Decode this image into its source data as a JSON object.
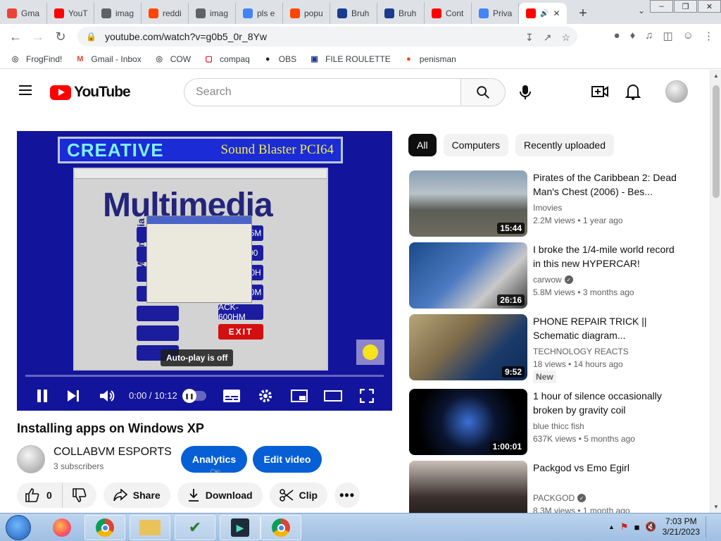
{
  "browser": {
    "tabs": [
      {
        "label": "Gma",
        "icon": "gmail-icon",
        "color": "#ea4335"
      },
      {
        "label": "YouT",
        "icon": "youtube-icon",
        "color": "#ff0000"
      },
      {
        "label": "imag",
        "icon": "globe-icon",
        "color": "#5f6368"
      },
      {
        "label": "reddi",
        "icon": "reddit-icon",
        "color": "#ff4500"
      },
      {
        "label": "imag",
        "icon": "globe-icon",
        "color": "#5f6368"
      },
      {
        "label": "pls e",
        "icon": "google-icon",
        "color": "#4285f4"
      },
      {
        "label": "popu",
        "icon": "reddit-icon",
        "color": "#ff4500"
      },
      {
        "label": "Bruh",
        "icon": "bruh-icon",
        "color": "#1a3c8c"
      },
      {
        "label": "Bruh",
        "icon": "bruh-icon",
        "color": "#1a3c8c"
      },
      {
        "label": "Cont",
        "icon": "youtube-icon",
        "color": "#ff0000"
      },
      {
        "label": "Priva",
        "icon": "google-icon",
        "color": "#4285f4"
      }
    ],
    "url": "youtube.com/watch?v=g0b5_0r_8Yw",
    "bookmarks": [
      {
        "label": "FrogFind!",
        "icon": "globe-icon"
      },
      {
        "label": "Gmail - Inbox",
        "icon": "gmail-icon"
      },
      {
        "label": "COW",
        "icon": "globe-icon"
      },
      {
        "label": "compaq",
        "icon": "compaq-icon"
      },
      {
        "label": "OBS",
        "icon": "github-icon"
      },
      {
        "label": "FILE ROULETTE",
        "icon": "file-roulette-icon"
      },
      {
        "label": "penisman",
        "icon": "reddit-icon"
      }
    ]
  },
  "youtube": {
    "logo_text": "YouTube",
    "search_placeholder": "Search",
    "video": {
      "banner_brand": "CREATIVE",
      "banner_product": "Sound Blaster PCI64",
      "screen_heading": "Multimedia",
      "autoplay_tooltip": "Auto-play is off",
      "time": "0:00 / 10:12",
      "buttons_right": [
        "ACK-595M",
        "ACK-600",
        "ACK-600H",
        "ACK-600M",
        "ACK-600HM",
        "EXIT"
      ]
    },
    "title": "Installing apps on Windows XP",
    "channel": {
      "name": "COLLABVM ESPORTS",
      "subs": "3 subscribers"
    },
    "analytics_label": "Analytics",
    "edit_label": "Edit video",
    "likes": "0",
    "share_label": "Share",
    "download_label": "Download",
    "clip_label": "Clip",
    "chips": [
      "All",
      "Computers",
      "Recently uploaded"
    ],
    "recommendations": [
      {
        "title": "Pirates of the Caribbean 2: Dead Man's Chest (2006) - Bes...",
        "channel": "Imovies",
        "verified": false,
        "meta": "2.2M views  •  1 year ago",
        "duration": "15:44",
        "new": false
      },
      {
        "title": "I broke the 1/4-mile world record in this new HYPERCAR!",
        "channel": "carwow",
        "verified": true,
        "meta": "5.8M views  •  3 months ago",
        "duration": "26:16",
        "new": false
      },
      {
        "title": "PHONE REPAIR TRICK || Schematic diagram...",
        "channel": "TECHNOLOGY REACTS",
        "verified": false,
        "meta": "18 views  •  14 hours ago",
        "duration": "9:52",
        "new": true,
        "badge": "New"
      },
      {
        "title": "1 hour of silence occasionally broken by gravity coil",
        "channel": "blue thicc fish",
        "verified": false,
        "meta": "637K views  •  5 months ago",
        "duration": "1:00:01",
        "new": false
      },
      {
        "title": "Packgod vs Emo Egirl",
        "channel": "PACKGOD",
        "verified": true,
        "meta": "8.3M views  •  1 month ago",
        "duration": "",
        "new": false
      }
    ]
  },
  "taskbar": {
    "time": "7:03 PM",
    "date": "3/21/2023"
  }
}
